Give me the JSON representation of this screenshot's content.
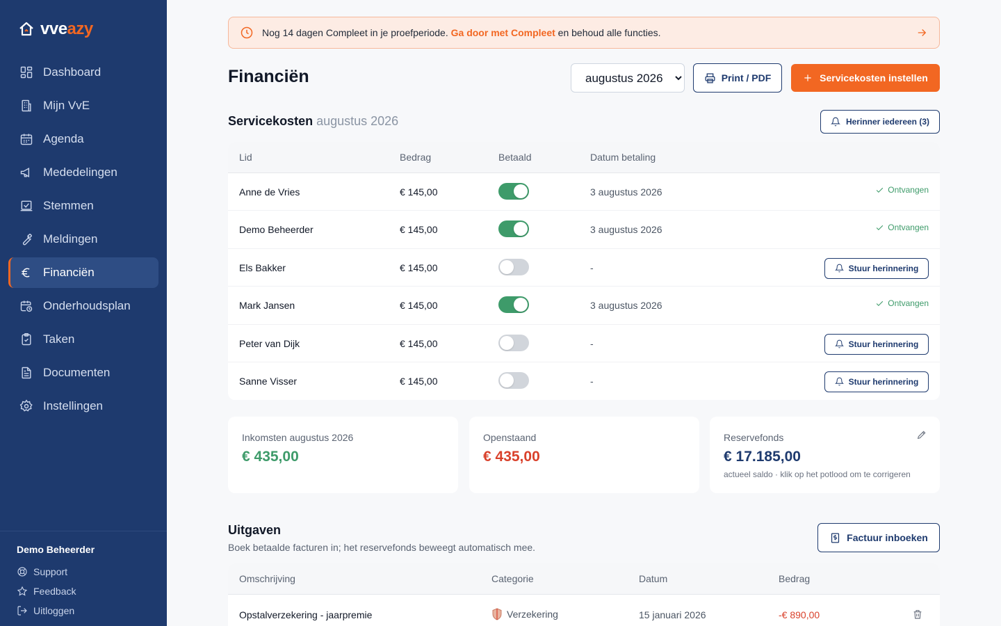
{
  "brand": {
    "part1": "vve",
    "part2": "azy"
  },
  "nav": [
    {
      "label": "Dashboard",
      "icon": "grid-icon"
    },
    {
      "label": "Mijn VvE",
      "icon": "building-icon"
    },
    {
      "label": "Agenda",
      "icon": "calendar-icon"
    },
    {
      "label": "Mededelingen",
      "icon": "megaphone-icon"
    },
    {
      "label": "Stemmen",
      "icon": "vote-icon"
    },
    {
      "label": "Meldingen",
      "icon": "wrench-icon"
    },
    {
      "label": "Financiën",
      "icon": "euro-icon",
      "active": true
    },
    {
      "label": "Onderhoudsplan",
      "icon": "calendar-clock-icon"
    },
    {
      "label": "Taken",
      "icon": "clipboard-check-icon"
    },
    {
      "label": "Documenten",
      "icon": "document-icon"
    },
    {
      "label": "Instellingen",
      "icon": "gear-icon"
    }
  ],
  "footer": {
    "user": "Demo Beheerder",
    "links": [
      "Support",
      "Feedback",
      "Uitloggen"
    ]
  },
  "banner": {
    "text_before": "Nog 14 dagen Compleet in je proefperiode. ",
    "link": "Ga door met Compleet",
    "text_after": " en behoud alle functies."
  },
  "page": {
    "title": "Financiën",
    "month_selected": "augustus 2026",
    "print_label": "Print / PDF",
    "primary_label": "Servicekosten instellen"
  },
  "servicecosts": {
    "title": "Servicekosten",
    "period": "augustus 2026",
    "remind_all_label": "Herinner iedereen (3)",
    "headers": {
      "member": "Lid",
      "amount": "Bedrag",
      "paid": "Betaald",
      "date": "Datum betaling"
    },
    "received_label": "Ontvangen",
    "remind_label": "Stuur herinnering",
    "rows": [
      {
        "name": "Anne de Vries",
        "amount": "€ 145,00",
        "paid": true,
        "date": "3 augustus 2026"
      },
      {
        "name": "Demo Beheerder",
        "amount": "€ 145,00",
        "paid": true,
        "date": "3 augustus 2026"
      },
      {
        "name": "Els Bakker",
        "amount": "€ 145,00",
        "paid": false,
        "date": "-"
      },
      {
        "name": "Mark Jansen",
        "amount": "€ 145,00",
        "paid": true,
        "date": "3 augustus 2026"
      },
      {
        "name": "Peter van Dijk",
        "amount": "€ 145,00",
        "paid": false,
        "date": "-"
      },
      {
        "name": "Sanne Visser",
        "amount": "€ 145,00",
        "paid": false,
        "date": "-"
      }
    ]
  },
  "stats": {
    "income": {
      "label": "Inkomsten augustus 2026",
      "value": "€ 435,00"
    },
    "outstanding": {
      "label": "Openstaand",
      "value": "€ 435,00"
    },
    "reserve": {
      "label": "Reservefonds",
      "value": "€ 17.185,00",
      "sub": "actueel saldo · klik op het potlood om te corrigeren"
    }
  },
  "expenses": {
    "title": "Uitgaven",
    "subtitle": "Boek betaalde facturen in; het reservefonds beweegt automatisch mee.",
    "button_label": "Factuur inboeken",
    "headers": {
      "desc": "Omschrijving",
      "cat": "Categorie",
      "date": "Datum",
      "amount": "Bedrag"
    },
    "rows": [
      {
        "desc": "Opstalverzekering - jaarpremie",
        "cat": "Verzekering",
        "date": "15 januari 2026",
        "amount": "-€ 890,00"
      }
    ]
  },
  "colors": {
    "sidebar": "#1e3a6e",
    "accent": "#f26722",
    "success": "#3e9b6a",
    "danger": "#d9412b"
  }
}
